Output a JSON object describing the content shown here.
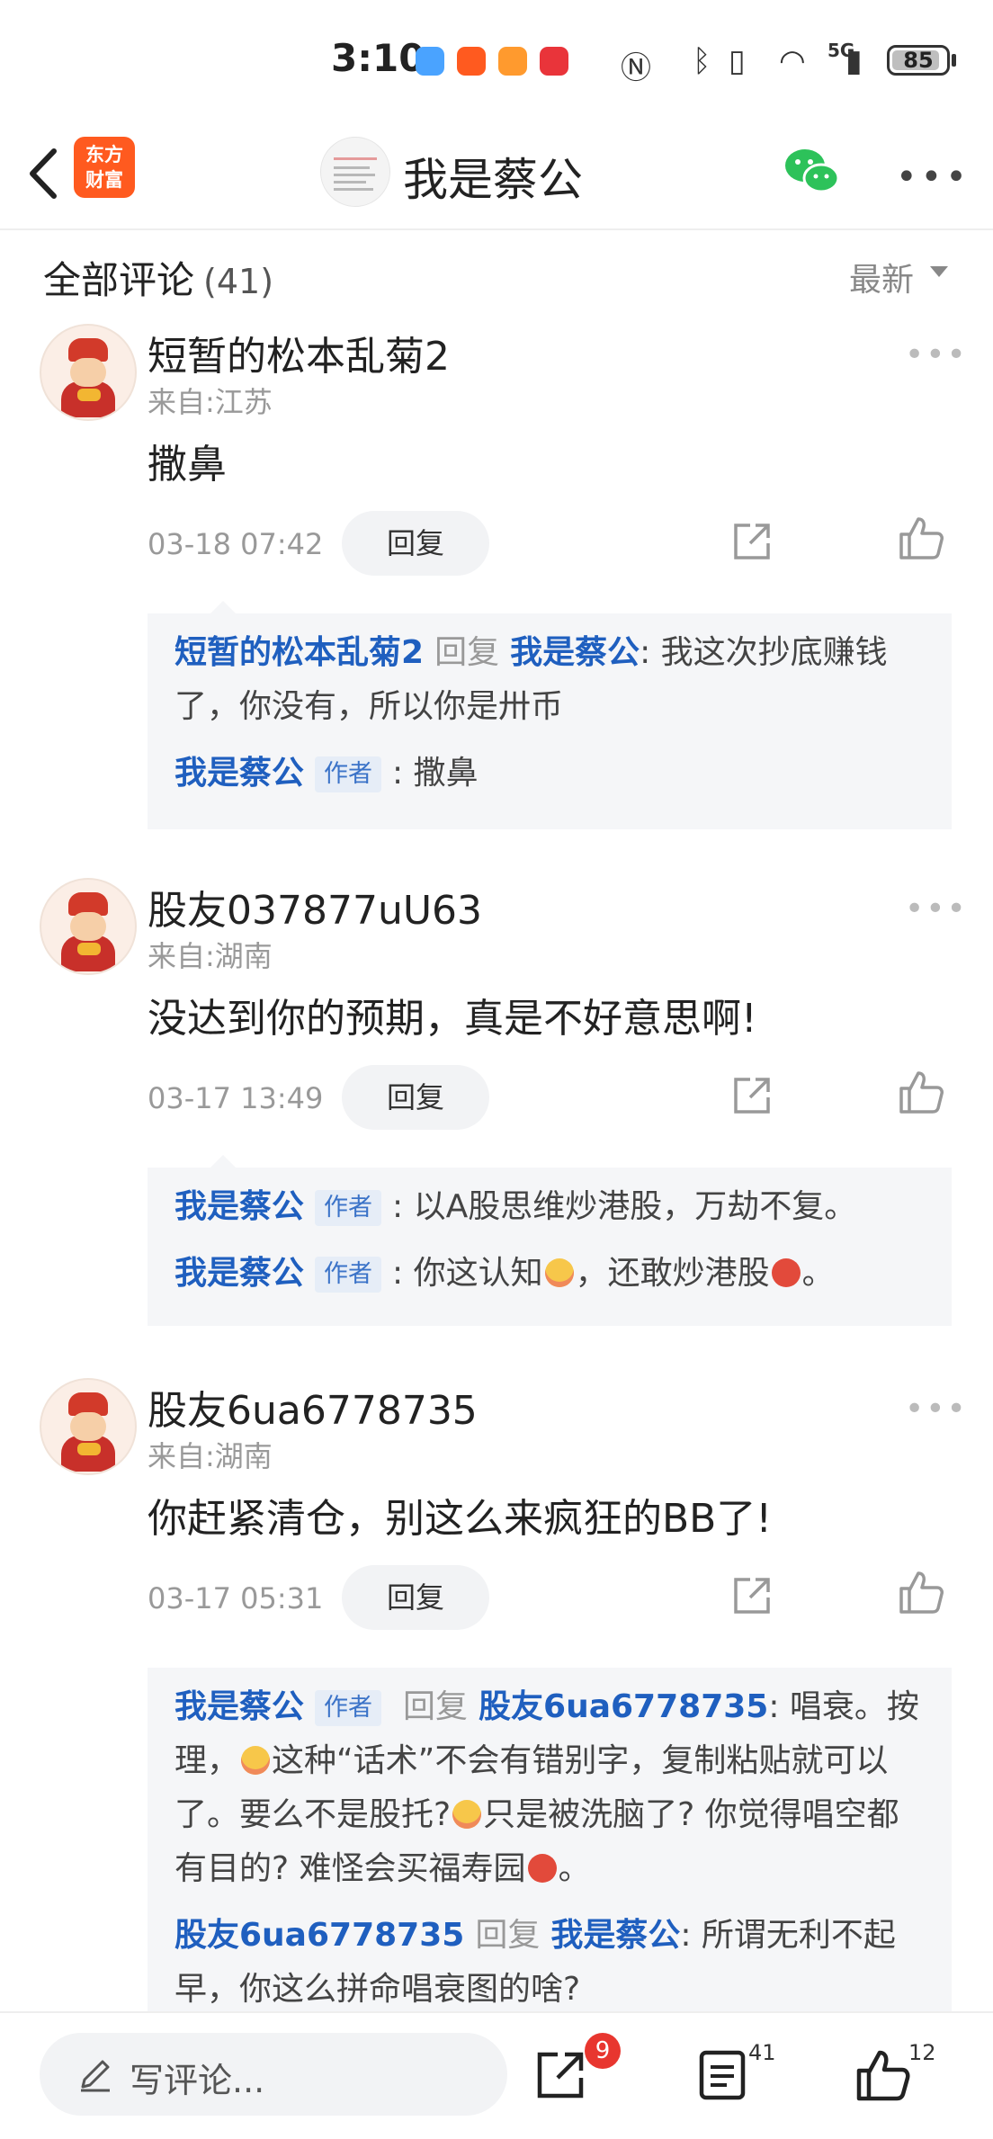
{
  "status_bar": {
    "time": "3:10",
    "network": "5G",
    "battery": "85"
  },
  "header": {
    "logo_line1": "东方",
    "logo_line2": "财富",
    "title": "我是蔡公"
  },
  "comments_section": {
    "title": "全部评论",
    "count": "(41)",
    "sort_label": "最新"
  },
  "comments": [
    {
      "user": "短暂的松本乱菊2",
      "from": "来自:江苏",
      "text": "撒鼻",
      "time": "03-18 07:42",
      "reply_label": "回复",
      "replies": [
        {
          "user": "短暂的松本乱菊2",
          "reply_word": "回复",
          "target": "我是蔡公",
          "text": ": 我这次抄底赚钱了，你没有，所以你是卅币"
        },
        {
          "user": "我是蔡公",
          "tag": "作者",
          "text": ": 撒鼻"
        }
      ]
    },
    {
      "user": "股友037877uU63",
      "from": "来自:湖南",
      "text": "没达到你的预期，真是不好意思啊!",
      "time": "03-17 13:49",
      "reply_label": "回复",
      "replies": [
        {
          "user": "我是蔡公",
          "tag": "作者",
          "text": ": 以A股思维炒港股，万劫不复。"
        },
        {
          "user": "我是蔡公",
          "tag": "作者",
          "text_a": ": 你这认知",
          "text_b": "，还敢炒港股",
          "text_c": "。"
        }
      ]
    },
    {
      "user": "股友6ua6778735",
      "from": "来自:湖南",
      "text": "你赶紧清仓，别这么来疯狂的BB了!",
      "time": "03-17 05:31",
      "reply_label": "回复",
      "replies": [
        {
          "user": "我是蔡公",
          "tag": "作者",
          "reply_word": "回复",
          "target": "股友6ua6778735",
          "text_a": ": 唱衰。按理，",
          "text_b": "这种“话术”不会有错别字，复制粘贴就可以了。要么不是股托?",
          "text_c": "只是被洗脑了? 你觉得唱空都有目的? 难怪会买福寿园",
          "text_d": "。"
        },
        {
          "user": "股友6ua6778735",
          "reply_word": "回复",
          "target": "我是蔡公",
          "text": ": 所谓无利不起早，你这么拼命唱衰图的啥?"
        }
      ]
    }
  ],
  "bottom_bar": {
    "write_placeholder": "写评论...",
    "share_badge": "9",
    "comment_count": "41",
    "like_count": "12"
  },
  "colors": {
    "brand": "#ff5a1f",
    "link_blue": "#1f5fbf",
    "badge_red": "#e8362f"
  }
}
